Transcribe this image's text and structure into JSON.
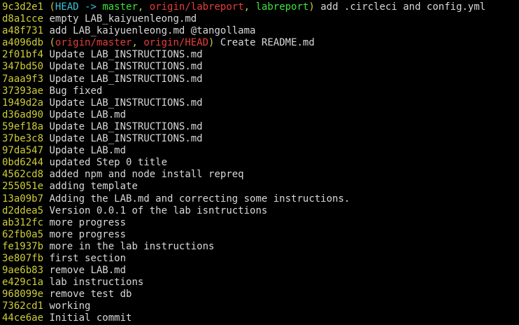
{
  "colors": {
    "background": "#000000",
    "hash": "#cdcd3a",
    "message": "#d8d8d8",
    "head": "#3fc0d6",
    "local_branch": "#3fe23f",
    "remote_branch": "#e63d3d"
  },
  "commits": [
    {
      "hash": "9c3d2e1",
      "refs": {
        "head": "HEAD",
        "arrow": " -> ",
        "head_branch": "master",
        "comma1": ", ",
        "remote1": "origin/labreport",
        "comma2": ", ",
        "local2": "labreport"
      },
      "message": "add .circleci and config.yml"
    },
    {
      "hash": "d8a1cce",
      "message": "empty LAB_kaiyuenleong.md"
    },
    {
      "hash": "a48f731",
      "message": "add LAB_kaiyuenleong.md @tangollama"
    },
    {
      "hash": "a4096db",
      "refs": {
        "remote1": "origin/master",
        "comma1": ", ",
        "remote2": "origin/HEAD"
      },
      "message": "Create README.md"
    },
    {
      "hash": "2f01bf4",
      "message": "Update LAB_INSTRUCTIONS.md"
    },
    {
      "hash": "347bd50",
      "message": "Update LAB_INSTRUCTIONS.md"
    },
    {
      "hash": "7aaa9f3",
      "message": "Update LAB_INSTRUCTIONS.md"
    },
    {
      "hash": "37393ae",
      "message": "Bug fixed"
    },
    {
      "hash": "1949d2a",
      "message": "Update LAB_INSTRUCTIONS.md"
    },
    {
      "hash": "d36ad90",
      "message": "Update LAB.md"
    },
    {
      "hash": "59ef18a",
      "message": "Update LAB_INSTRUCTIONS.md"
    },
    {
      "hash": "37be3c8",
      "message": "Update LAB_INSTRUCTIONS.md"
    },
    {
      "hash": "97da547",
      "message": "Update LAB.md"
    },
    {
      "hash": "0bd6244",
      "message": "updated Step 0 title"
    },
    {
      "hash": "4562cd8",
      "message": "added npm and node install repreq"
    },
    {
      "hash": "255051e",
      "message": "adding template"
    },
    {
      "hash": "13a09b7",
      "message": "Adding the LAB.md and correcting some instructions."
    },
    {
      "hash": "d2ddea5",
      "message": "Version 0.0.1 of the lab isntructions"
    },
    {
      "hash": "ab312fc",
      "message": "more progress"
    },
    {
      "hash": "62fb0a5",
      "message": "more progress"
    },
    {
      "hash": "fe1937b",
      "message": "more in the lab instructions"
    },
    {
      "hash": "3e807fb",
      "message": "first section"
    },
    {
      "hash": "9ae6b83",
      "message": "remove LAB.md"
    },
    {
      "hash": "e429c1a",
      "message": "lab instructions"
    },
    {
      "hash": "968099e",
      "message": "remove test db"
    },
    {
      "hash": "7362cd1",
      "message": "working"
    },
    {
      "hash": "44ce6ae",
      "message": "Initial commit"
    }
  ]
}
